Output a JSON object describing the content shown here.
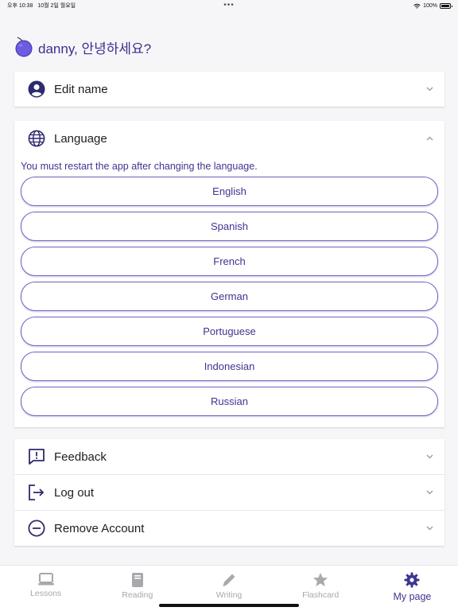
{
  "status_bar": {
    "time": "오후 10:38",
    "date": "10월 2일 월요일",
    "battery": "100%",
    "battery_level": 1.0
  },
  "header": {
    "greeting": "danny, 안녕하세요?",
    "avatar_icon": "plum-fruit-icon"
  },
  "sections": {
    "edit_name": {
      "label": "Edit name",
      "icon": "user-circle-icon"
    },
    "language": {
      "label": "Language",
      "icon": "globe-icon",
      "note": "You must restart the app after changing the language.",
      "options": [
        "English",
        "Spanish",
        "French",
        "German",
        "Portuguese",
        "Indonesian",
        "Russian"
      ]
    },
    "feedback": {
      "label": "Feedback",
      "icon": "message-alert-icon"
    },
    "logout": {
      "label": "Log out",
      "icon": "logout-icon"
    },
    "remove_account": {
      "label": "Remove Account",
      "icon": "minus-circle-icon"
    }
  },
  "tabs": [
    {
      "label": "Lessons",
      "icon": "laptop-icon"
    },
    {
      "label": "Reading",
      "icon": "book-icon"
    },
    {
      "label": "Writing",
      "icon": "pencil-icon"
    },
    {
      "label": "Flashcard",
      "icon": "star-icon"
    },
    {
      "label": "My page",
      "icon": "gear-icon",
      "active": true
    }
  ],
  "colors": {
    "accent": "#3e3591",
    "inactive": "#a8a8ad",
    "background": "#f6f6f8"
  }
}
